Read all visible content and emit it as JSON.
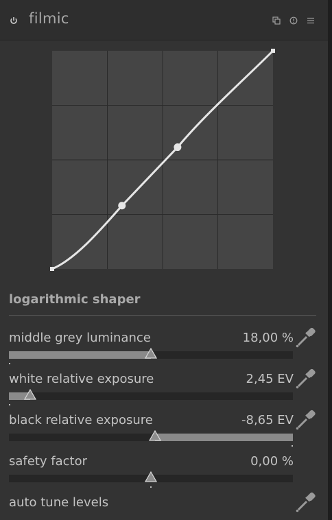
{
  "module": {
    "title": "filmic",
    "icons": [
      "power-icon",
      "presets-icon",
      "reset-icon",
      "menu-icon"
    ]
  },
  "curve": {
    "grid": true,
    "nodes": [
      {
        "x": 0.0,
        "y": 0.0
      },
      {
        "x": 0.316,
        "y": 0.29
      },
      {
        "x": 0.568,
        "y": 0.558
      },
      {
        "x": 1.0,
        "y": 1.0
      }
    ],
    "colors": {
      "background": "#454545",
      "grid": "#2a2a2a",
      "curve": "#e6e6e6"
    }
  },
  "section": {
    "title": "logarithmic shaper"
  },
  "sliders": [
    {
      "label": "middle grey luminance",
      "value": "18,00 %",
      "fill_fraction": 0.5,
      "fill_from": "left",
      "icon": "color-picker-icon"
    },
    {
      "label": "white relative exposure",
      "value": "2,45 EV",
      "fill_fraction": 0.074,
      "fill_from": "left",
      "icon": "color-picker-icon"
    },
    {
      "label": "black relative exposure",
      "value": "-8,65 EV",
      "fill_fraction": 0.485,
      "fill_from": "right",
      "icon": "color-picker-icon"
    },
    {
      "label": "safety factor",
      "value": "0,00 %",
      "fill_fraction": 0.5,
      "fill_from": "center",
      "icon": null
    }
  ],
  "auto_tune": {
    "label": "auto tune levels",
    "icon": "color-picker-icon"
  }
}
